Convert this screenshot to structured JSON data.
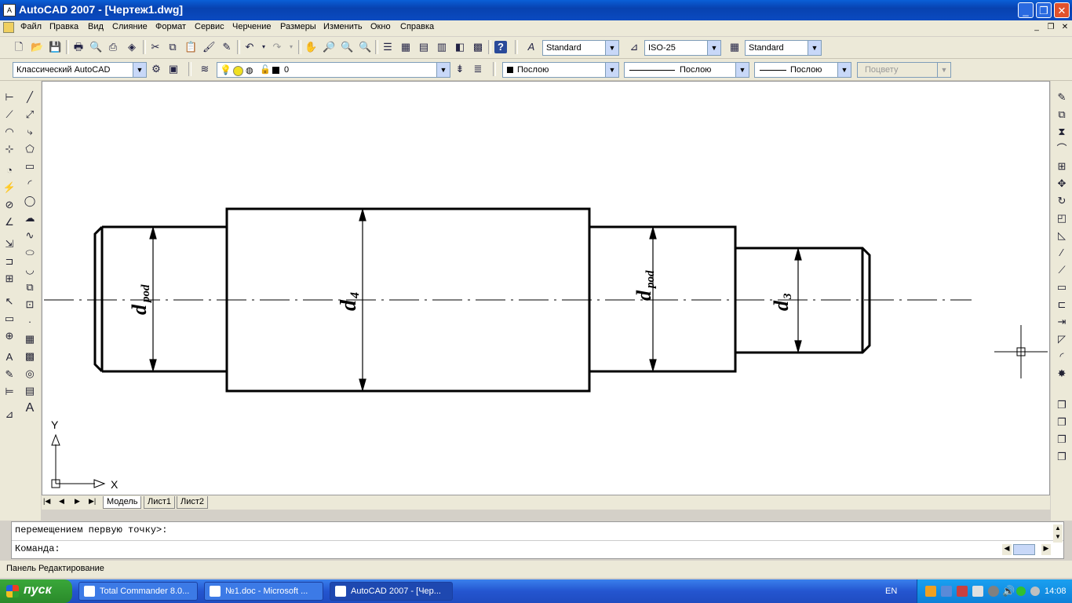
{
  "window": {
    "title": "AutoCAD 2007 - [Чертеж1.dwg]",
    "minimize_glyph": "_",
    "restore_glyph": "❐",
    "close_glyph": "✕"
  },
  "menu": [
    "Файл",
    "Правка",
    "Вид",
    "Слияние",
    "Формат",
    "Сервис",
    "Черчение",
    "Размеры",
    "Изменить",
    "Окно",
    "Справка"
  ],
  "mdi_controls": [
    "_",
    "❐",
    "✕"
  ],
  "toolbar1": {
    "text_style": "Standard",
    "dim_style": "ISO-25",
    "table_style": "Standard"
  },
  "toolbar2": {
    "workspace": "Классический AutoCAD",
    "layer": "0",
    "color": "Послою",
    "linetype": "Послою",
    "lineweight": "Послою",
    "plotstyle": "Поцвету"
  },
  "drawing": {
    "label_d_left": "d",
    "label_d_left_sub": "pod",
    "label_d4": "d",
    "label_d4_sub": "4",
    "label_d_right": "d",
    "label_d_right_sub": "pod",
    "label_d3": "d",
    "label_d3_sub": "3",
    "ucs_x": "X",
    "ucs_y": "Y"
  },
  "layout_tabs": [
    "Модель",
    "Лист1",
    "Лист2"
  ],
  "command": {
    "history": "перемещением первую точку>:",
    "prompt": "Команда:"
  },
  "status": {
    "text": "Панель Редактирование"
  },
  "taskbar": {
    "start": "пуск",
    "tasks": [
      "Total Commander 8.0...",
      "№1.doc - Microsoft ...",
      "AutoCAD 2007 - [Чер..."
    ],
    "lang": "EN",
    "clock": "14:08"
  },
  "icons": {
    "left_col1": [
      "linear-dim-icon",
      "aligned-dim-icon",
      "arc-length-icon",
      "ordinate-dim-icon",
      "radius-dim-icon",
      "jogged-dim-icon",
      "diameter-dim-icon",
      "angular-dim-icon",
      "quick-dim-icon",
      "baseline-dim-icon",
      "continue-dim-icon",
      "quick-leader-icon",
      "tolerance-icon",
      "center-mark-icon",
      "dim-edit-icon",
      "dim-text-edit-icon",
      "dim-update-icon",
      "dim-style-icon"
    ],
    "left_col2": [
      "line-icon",
      "construction-line-icon",
      "polyline-icon",
      "polygon-icon",
      "rectangle-icon",
      "arc-icon",
      "circle-icon",
      "revcloud-icon",
      "spline-icon",
      "ellipse-icon",
      "ellipse-arc-icon",
      "insert-block-icon",
      "make-block-icon",
      "point-icon",
      "hatch-icon",
      "gradient-icon",
      "region-icon",
      "table-icon",
      "mtext-icon"
    ],
    "right_col": [
      "erase-icon",
      "copy-icon",
      "mirror-icon",
      "offset-icon",
      "array-icon",
      "move-icon",
      "rotate-icon",
      "scale-icon",
      "stretch-icon",
      "trim-icon",
      "extend-icon",
      "break-at-point-icon",
      "break-icon",
      "join-icon",
      "chamfer-icon",
      "fillet-icon",
      "explode-icon",
      "draworder-front-icon",
      "draworder-back-icon",
      "draworder-above-icon",
      "draworder-under-icon"
    ]
  }
}
